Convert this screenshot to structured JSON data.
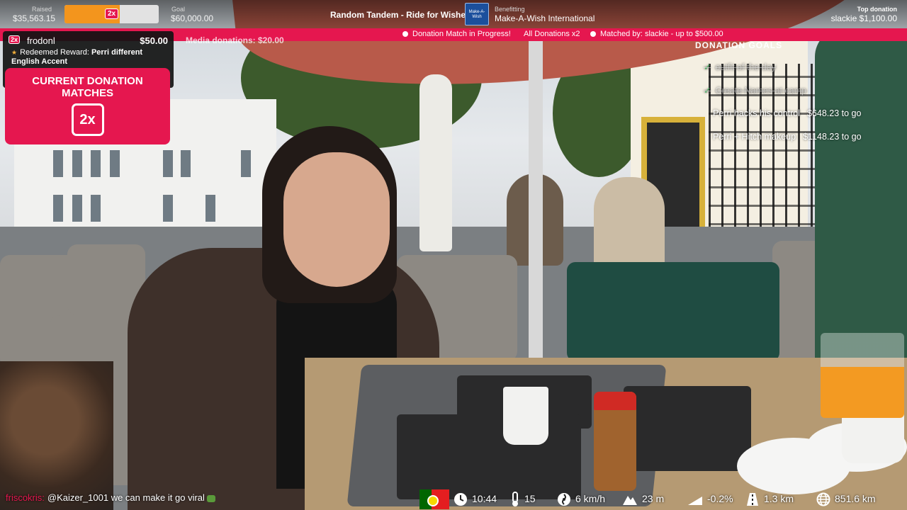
{
  "fundraiser": {
    "raised_label": "Raised",
    "raised_value": "$35,563.15",
    "progress_fraction": 0.59,
    "multiplier": "2x",
    "goal_label": "Goal",
    "goal_value": "$60,000.00",
    "campaign_title": "Random Tandem - Ride for Wishes",
    "charity_logo_text": "Make-A-Wish",
    "benefit_label": "Benefitting",
    "benefit_value": "Make-A-Wish International",
    "top_label": "Top donation",
    "top_value": "slackie $1,100.00"
  },
  "match_banner": {
    "status": "Donation Match in Progress!",
    "multiplier_text": "All Donations x2",
    "matched_by": "Matched by:  slackie - up to $500.00"
  },
  "alert": {
    "badge": "2x",
    "user": "frodonl",
    "amount": "$50.00",
    "reward_prefix": "Redeemed Reward: ",
    "reward_name": "Perri different English Accent"
  },
  "match_card": {
    "title": "Current Donation Matches",
    "badge": "2x"
  },
  "media_donations": "Media donations: $20.00",
  "donation_goals": {
    "title": "Donation Goals",
    "items": [
      {
        "label": "outfit of the day",
        "amount": "",
        "done": true
      },
      {
        "label": "Create Names at camp",
        "amount": "",
        "done": true
      },
      {
        "label": "Perri hacks his control",
        "amount": "$648.23 to go",
        "done": false
      },
      {
        "label": "Perri + Hitch makeup",
        "amount": "$1148.23 to go",
        "done": false
      }
    ]
  },
  "chat": {
    "user": "friscokris:",
    "message": "@Kaizer_1001 we can make it go viral"
  },
  "stats": {
    "time": "10:44",
    "temperature": "15",
    "wind": "6 km/h",
    "altitude": "23 m",
    "grade": "-0.2%",
    "distance": "1.3 km",
    "total_distance": "851.6 km"
  },
  "colors": {
    "accent": "#e5174f",
    "progress": "#f3951d",
    "overlay": "#121212"
  }
}
